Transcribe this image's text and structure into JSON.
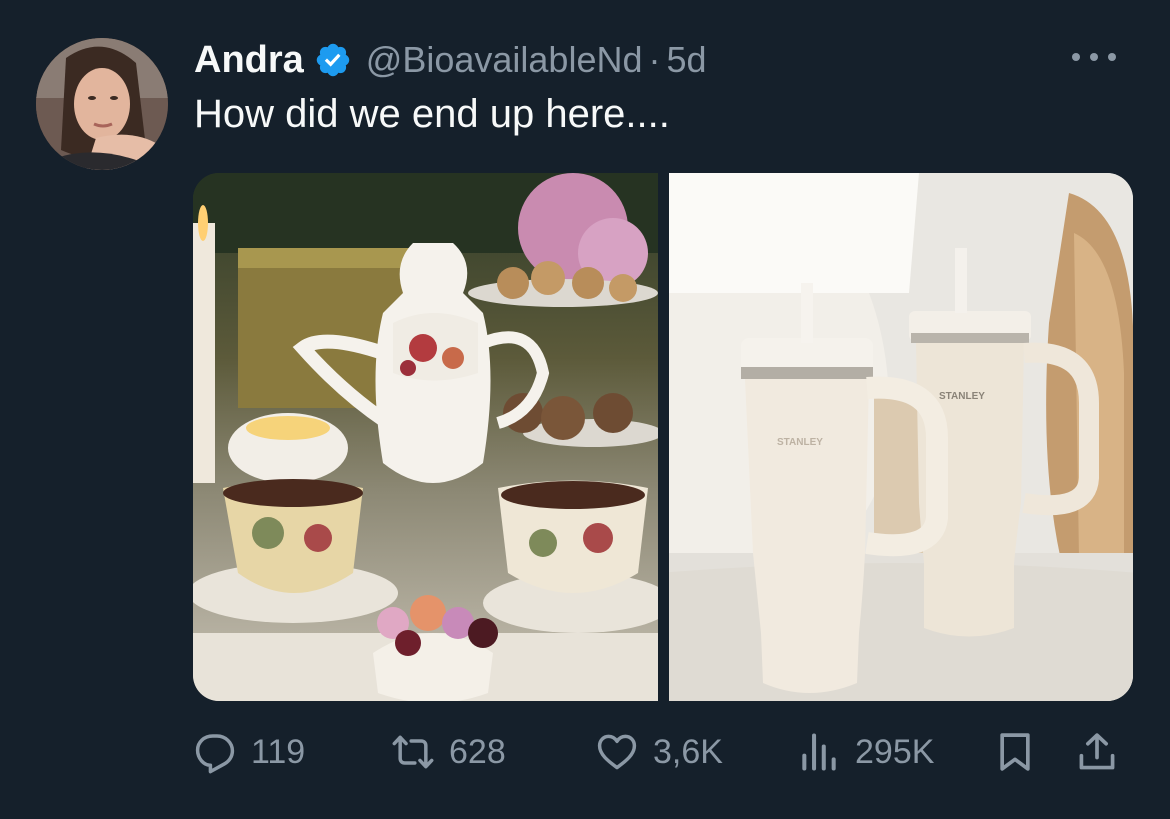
{
  "author": {
    "name": "Andra",
    "handle": "@BioavailableNd",
    "time": "5d",
    "separator": "·"
  },
  "tweet": {
    "text": "How did we end up here...."
  },
  "media": {
    "left_brand_text": "STANLEY",
    "right_brand_text": "STANLEY"
  },
  "actions": {
    "replies": "119",
    "retweets": "628",
    "likes": "3,6K",
    "views": "295K"
  },
  "colors": {
    "background": "#15202b",
    "primary_text": "#f7f9f9",
    "secondary_text": "#8b98a5",
    "verified": "#1d9bf0"
  },
  "icons": [
    "verified-badge-icon",
    "more-icon",
    "reply-icon",
    "retweet-icon",
    "like-icon",
    "views-icon",
    "bookmark-icon",
    "share-icon"
  ]
}
